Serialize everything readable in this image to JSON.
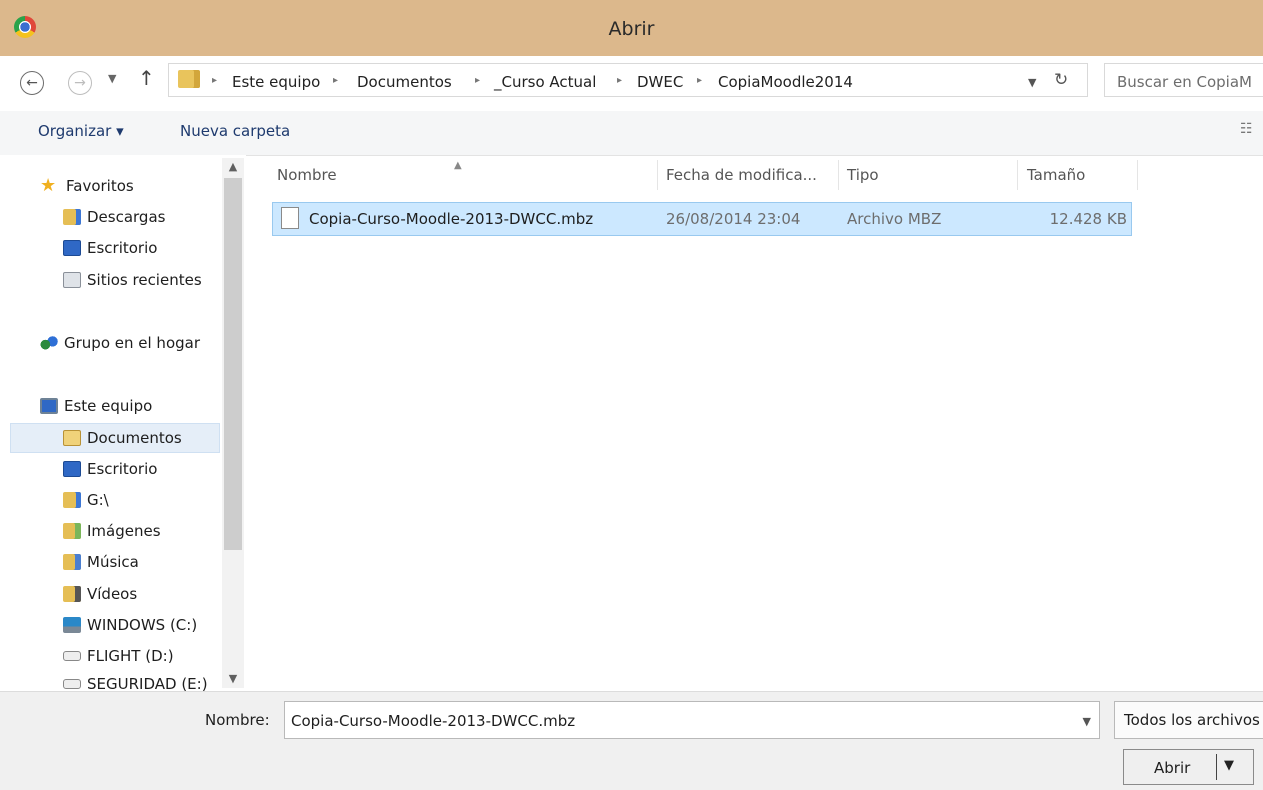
{
  "window": {
    "title": "Abrir"
  },
  "address": {
    "crumbs": [
      "Este equipo",
      "Documentos",
      "_Curso Actual",
      "DWEC",
      "CopiaMoodle2014"
    ],
    "separator": "▸",
    "search_placeholder": "Buscar en CopiaM"
  },
  "toolbar": {
    "organize_label": "Organizar ▾",
    "new_folder_label": "Nueva carpeta"
  },
  "nav": {
    "favorites": "Favoritos",
    "downloads": "Descargas",
    "desktop": "Escritorio",
    "recent": "Sitios recientes",
    "homegroup": "Grupo en el hogar",
    "this_pc": "Este equipo",
    "documents": "Documentos",
    "pc_desktop": "Escritorio",
    "g_drive": "G:\\",
    "pictures": "Imágenes",
    "music": "Música",
    "videos": "Vídeos",
    "windows_c": "WINDOWS (C:)",
    "flight_d": "FLIGHT (D:)",
    "seguridad_e": "SEGURIDAD (E:)"
  },
  "columns": {
    "name": "Nombre",
    "date": "Fecha de modifica...",
    "type": "Tipo",
    "size": "Tamaño"
  },
  "files": [
    {
      "name": "Copia-Curso-Moodle-2013-DWCC.mbz",
      "date": "26/08/2014 23:04",
      "type": "Archivo MBZ",
      "size": "12.428 KB"
    }
  ],
  "bottom": {
    "filename_label": "Nombre:",
    "filename_value": "Copia-Curso-Moodle-2013-DWCC.mbz",
    "filetype_label": "Todos los archivos",
    "open_label": "Abrir"
  },
  "colors": {
    "titlebar": "#dcb88c",
    "selection": "#cce8ff",
    "link": "#1e3a6e"
  }
}
